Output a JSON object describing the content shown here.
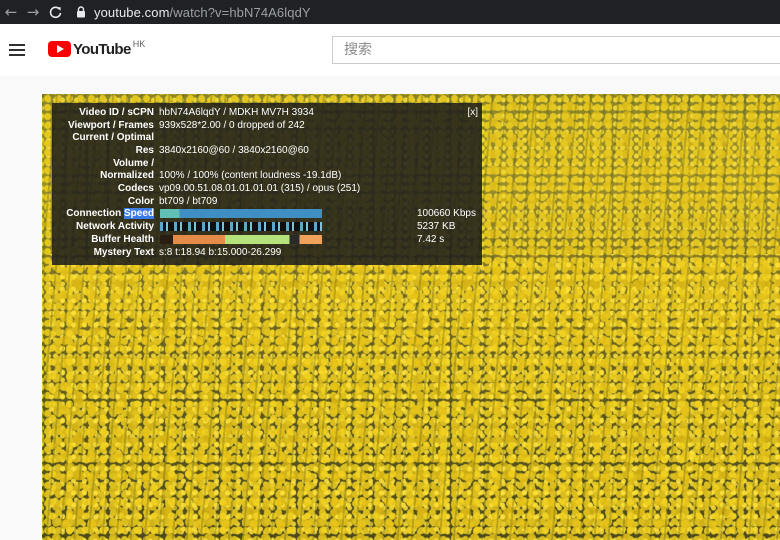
{
  "browser": {
    "url_host": "youtube.com",
    "url_rest": "/watch?v=hbN74A6lqdY",
    "back_icon": "arrow-left-icon",
    "forward_icon": "arrow-right-icon",
    "reload_icon": "reload-icon",
    "lock_icon": "lock-icon"
  },
  "header": {
    "logo_text": "YouTube",
    "region": "HK",
    "menu_icon": "hamburger-icon",
    "search_placeholder": "搜索"
  },
  "stats": {
    "close_label": "[x]",
    "rows": [
      {
        "label": "Video ID / sCPN",
        "value": "hbN74A6lqdY / MDKH MV7H 3934"
      },
      {
        "label": "Viewport / Frames",
        "value": "939x528*2.00 / 0 dropped of 242"
      },
      {
        "label": "Current / Optimal",
        "value": ""
      },
      {
        "label": "Res",
        "value": "3840x2160@60 / 3840x2160@60"
      },
      {
        "label": "Volume /",
        "value": ""
      },
      {
        "label": "Normalized",
        "value": "100% / 100% (content loudness -19.1dB)"
      },
      {
        "label": "Codecs",
        "value": "vp09.00.51.08.01.01.01.01 (315) / opus (251)"
      },
      {
        "label": "Color",
        "value": "bt709 / bt709"
      }
    ],
    "connection_label_pre": "Connection ",
    "connection_label_hl": "Speed",
    "connection_value": "100660 Kbps",
    "network_label": "Network Activity",
    "network_value": "5237 KB",
    "buffer_label": "Buffer Health",
    "buffer_value": "7.42 s",
    "mystery_label": "Mystery Text",
    "mystery_value": "s:8 t:18.94 b:15.000-26.299"
  },
  "colors": {
    "brand_red": "#ff0000",
    "stats_highlight": "#3b7be8",
    "chrome_bg": "#202124"
  }
}
